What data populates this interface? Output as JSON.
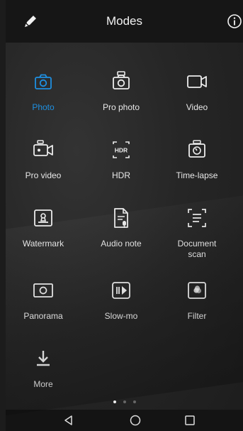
{
  "header": {
    "title": "Modes"
  },
  "modes": [
    {
      "label": "Photo",
      "icon": "camera-icon",
      "active": true
    },
    {
      "label": "Pro photo",
      "icon": "pro-camera-icon"
    },
    {
      "label": "Video",
      "icon": "video-camera-icon"
    },
    {
      "label": "Pro video",
      "icon": "pro-video-icon"
    },
    {
      "label": "HDR",
      "icon": "hdr-icon"
    },
    {
      "label": "Time-lapse",
      "icon": "time-lapse-icon"
    },
    {
      "label": "Watermark",
      "icon": "watermark-icon"
    },
    {
      "label": "Audio note",
      "icon": "audio-note-icon"
    },
    {
      "label": "Document scan",
      "icon": "document-scan-icon"
    },
    {
      "label": "Panorama",
      "icon": "panorama-icon"
    },
    {
      "label": "Slow-mo",
      "icon": "slow-mo-icon"
    },
    {
      "label": "Filter",
      "icon": "filter-icon"
    },
    {
      "label": "More",
      "icon": "download-icon"
    }
  ],
  "pager": {
    "pages": 3,
    "current": 1
  },
  "colors": {
    "accent": "#1e8fe0",
    "text": "#e8e8e8",
    "background": "#262626"
  },
  "nav": {
    "back_icon": "back-triangle-icon",
    "home_icon": "home-circle-icon",
    "recents_icon": "recents-square-icon"
  }
}
